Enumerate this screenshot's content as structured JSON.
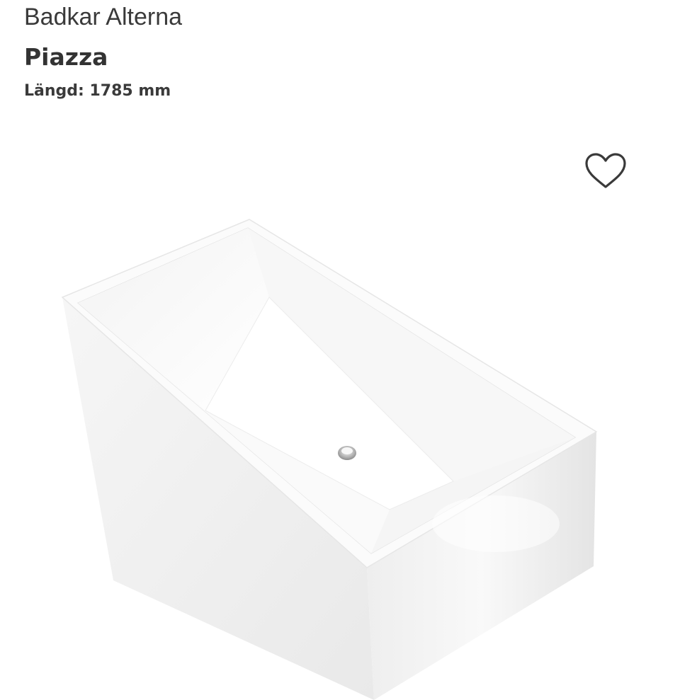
{
  "product": {
    "brand": "Badkar Alterna",
    "name": "Piazza",
    "spec": "Längd: 1785 mm"
  },
  "favorite": {
    "icon": "heart-outline-icon"
  },
  "image": {
    "alt": "Badkar Alterna Piazza fristående badkar"
  },
  "colors": {
    "text": "#333333",
    "accent": "#b64a4a",
    "background": "#ffffff"
  }
}
